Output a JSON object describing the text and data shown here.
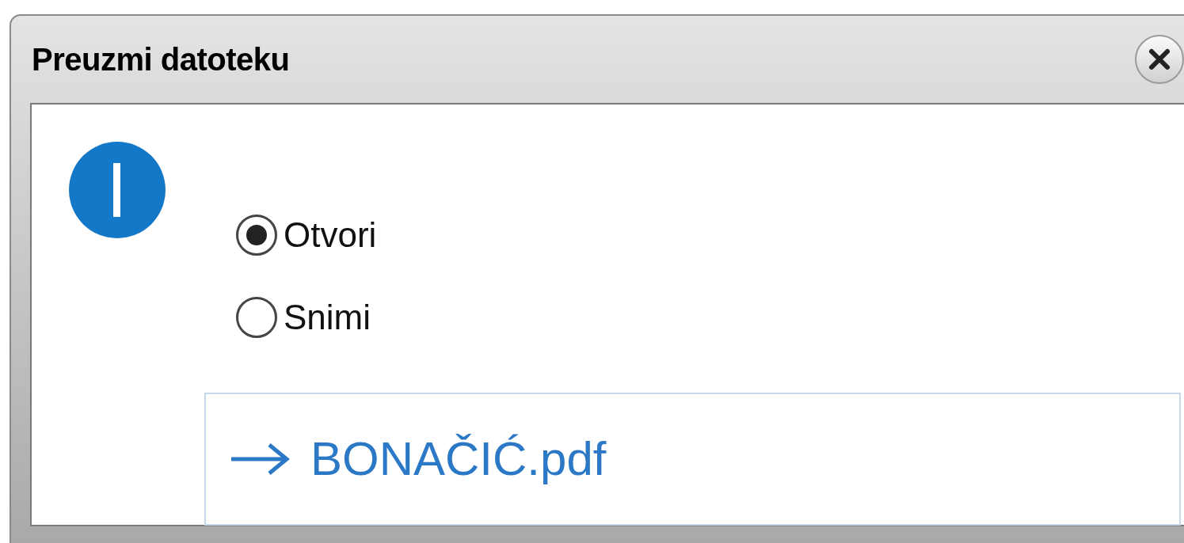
{
  "window": {
    "title": "Preuzmi datoteku"
  },
  "options": [
    {
      "label": "Otvori",
      "selected": true
    },
    {
      "label": "Snimi",
      "selected": false
    }
  ],
  "file_link": {
    "label": "BONAČIĆ.pdf"
  }
}
